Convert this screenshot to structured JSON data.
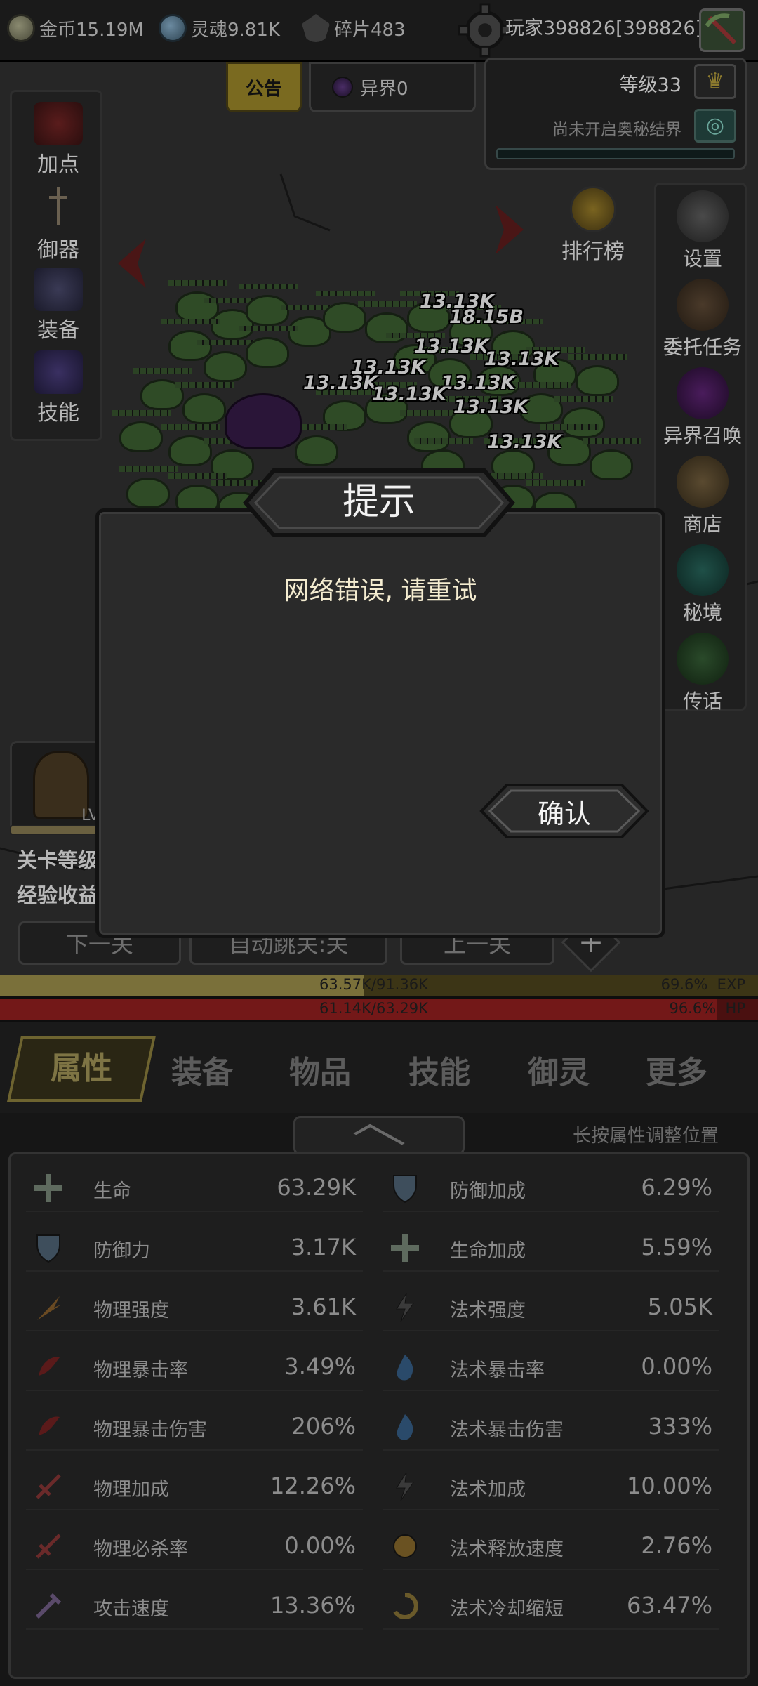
{
  "top_bar": {
    "gold": "金币15.19M",
    "soul": "灵魂9.81K",
    "shards": "碎片483",
    "player": "玩家398826[398826]"
  },
  "notice_tab": "公告",
  "otherworld_tab": "异界0",
  "level": "等级33",
  "barrier_text": "尚未开启奥秘结界",
  "left_menu": [
    "加点",
    "御器",
    "装备",
    "技能"
  ],
  "rank_label": "排行榜",
  "right_menu": [
    "设置",
    "委托任务",
    "异界召唤",
    "商店",
    "秘境",
    "传话"
  ],
  "damage_numbers": [
    "13.13K",
    "18.15B",
    "13.13K",
    "13.13K",
    "13.13K",
    "13.13K",
    "13.13K",
    "13.13K",
    "13.13K",
    "13.13K"
  ],
  "stage": {
    "lv_label": "LV",
    "line1": "关卡等级",
    "line2": "经验收益"
  },
  "nav": {
    "next": "下一关",
    "auto": "自动跳关:关",
    "prev": "上一关",
    "plus": "+"
  },
  "exp": {
    "value": "63.57K/91.36K",
    "percent": "69.6%",
    "label": "EXP",
    "fill": 0.696
  },
  "hp": {
    "value": "61.14K/63.29K",
    "percent": "96.6%",
    "label": "HP",
    "fill": 0.966
  },
  "tabs": [
    "属性",
    "装备",
    "物品",
    "技能",
    "御灵",
    "更多"
  ],
  "hint": "长按属性调整位置",
  "attributes_left": [
    {
      "icon": "health-cross-icon",
      "name": "生命",
      "value": "63.29K"
    },
    {
      "icon": "shield-icon",
      "name": "防御力",
      "value": "3.17K"
    },
    {
      "icon": "sword-slash-icon",
      "name": "物理强度",
      "value": "3.61K"
    },
    {
      "icon": "crit-claw-icon",
      "name": "物理暴击率",
      "value": "3.49%"
    },
    {
      "icon": "crit-claw-icon",
      "name": "物理暴击伤害",
      "value": "206%"
    },
    {
      "icon": "physical-boost-icon",
      "name": "物理加成",
      "value": "12.26%"
    },
    {
      "icon": "physical-boost-icon",
      "name": "物理必杀率",
      "value": "0.00%"
    },
    {
      "icon": "attack-speed-icon",
      "name": "攻击速度",
      "value": "13.36%"
    }
  ],
  "attributes_right": [
    {
      "icon": "shield-icon",
      "name": "防御加成",
      "value": "6.29%"
    },
    {
      "icon": "health-cross-icon",
      "name": "生命加成",
      "value": "5.59%"
    },
    {
      "icon": "lightning-icon",
      "name": "法术强度",
      "value": "5.05K"
    },
    {
      "icon": "blue-flame-icon",
      "name": "法术暴击率",
      "value": "0.00%"
    },
    {
      "icon": "blue-flame-icon",
      "name": "法术暴击伤害",
      "value": "333%"
    },
    {
      "icon": "lightning-icon",
      "name": "法术加成",
      "value": "10.00%"
    },
    {
      "icon": "cast-speed-icon",
      "name": "法术释放速度",
      "value": "2.76%"
    },
    {
      "icon": "cooldown-icon",
      "name": "法术冷却缩短",
      "value": "63.47%"
    }
  ],
  "modal": {
    "title": "提示",
    "message": "网络错误, 请重试",
    "confirm": "确认"
  },
  "colors": {
    "exp": "#7a703a",
    "hp": "#731818",
    "modal_title": "#f2f2f2",
    "modal_message": "#f4ecd0"
  }
}
